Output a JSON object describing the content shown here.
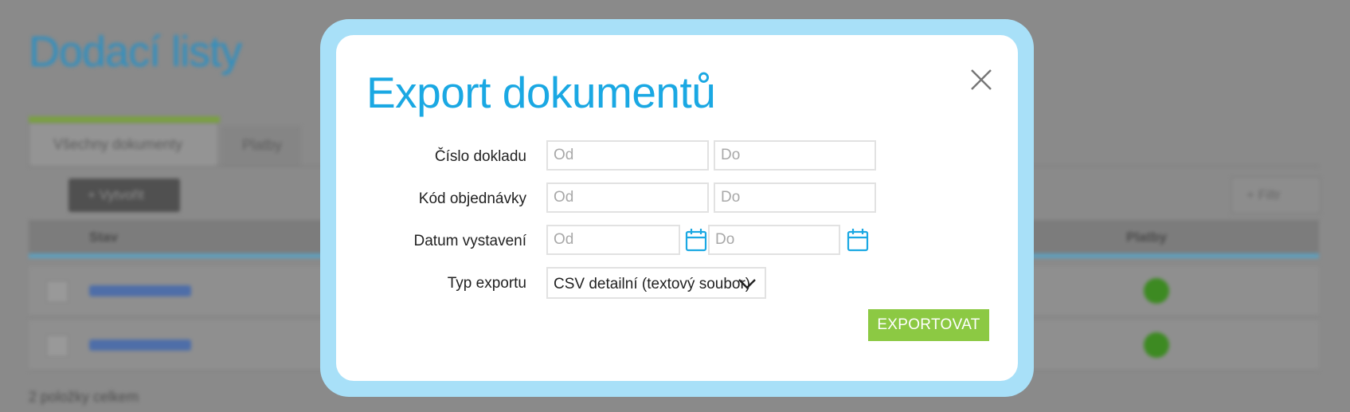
{
  "background": {
    "page_title": "Dodací listy",
    "tabs": [
      {
        "label": "Všechny dokumenty"
      },
      {
        "label": "Platby"
      }
    ],
    "new_button_label": "+ Vytvořit",
    "filter_button_label": "+ Filtr",
    "table_headers": {
      "name": "Stav",
      "payment": "Platby"
    },
    "footer_text": "2 položky celkem"
  },
  "modal": {
    "title": "Export dokumentů",
    "close_icon": "close-icon",
    "fields": {
      "document_number": {
        "label": "Číslo dokladu",
        "from_placeholder": "Od",
        "to_placeholder": "Do"
      },
      "order_code": {
        "label": "Kód objednávky",
        "from_placeholder": "Od",
        "to_placeholder": "Do"
      },
      "issue_date": {
        "label": "Datum vystavení",
        "from_placeholder": "Od",
        "to_placeholder": "Do",
        "icon": "calendar-icon"
      },
      "export_type": {
        "label": "Typ exportu",
        "selected": "CSV detailní (textový soubor)"
      }
    },
    "export_button_label": "EXPORTOVAT"
  },
  "colors": {
    "accent_blue": "#1aa8e3",
    "frame_blue": "#a8e0f8",
    "export_green": "#8cc943"
  }
}
